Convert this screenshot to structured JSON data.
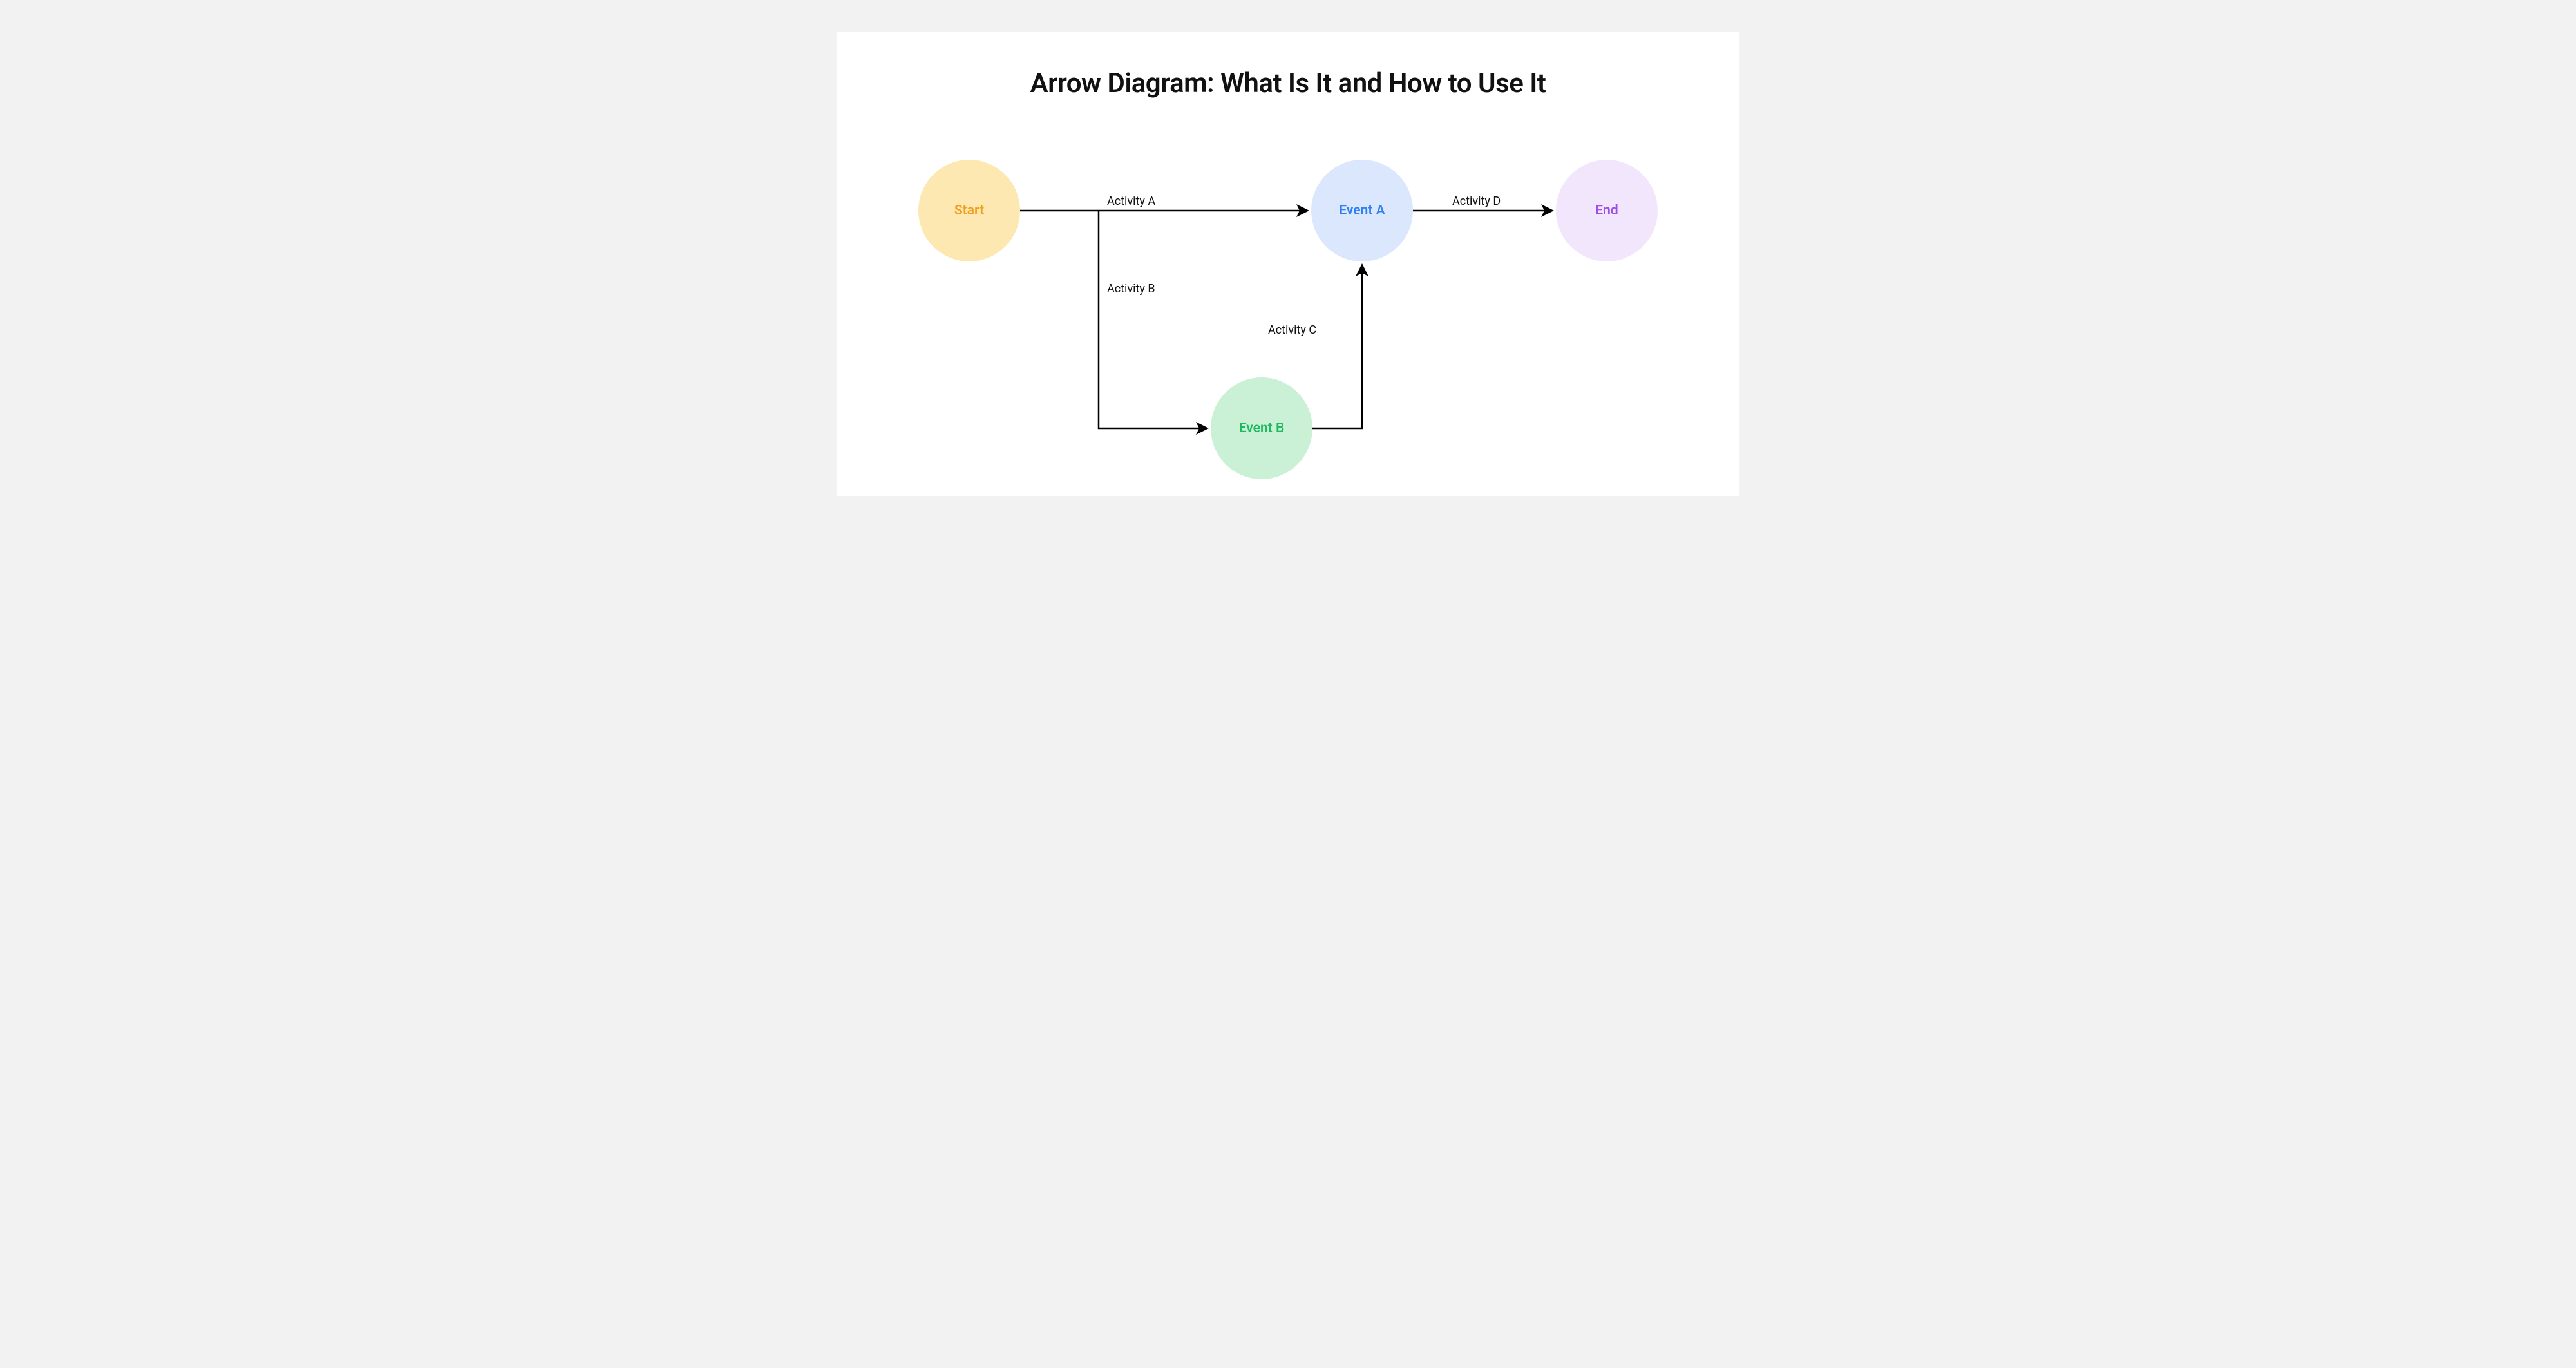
{
  "title": "Arrow Diagram: What Is It and How to Use It",
  "nodes": {
    "start": {
      "label": "Start"
    },
    "eventA": {
      "label": "Event A"
    },
    "eventB": {
      "label": "Event B"
    },
    "end": {
      "label": "End"
    }
  },
  "edges": {
    "activityA": {
      "label": "Activity A",
      "from": "start",
      "to": "eventA"
    },
    "activityB": {
      "label": "Activity B",
      "from": "start",
      "to": "eventB"
    },
    "activityC": {
      "label": "Activity C",
      "from": "eventB",
      "to": "eventA"
    },
    "activityD": {
      "label": "Activity D",
      "from": "eventA",
      "to": "end"
    }
  }
}
